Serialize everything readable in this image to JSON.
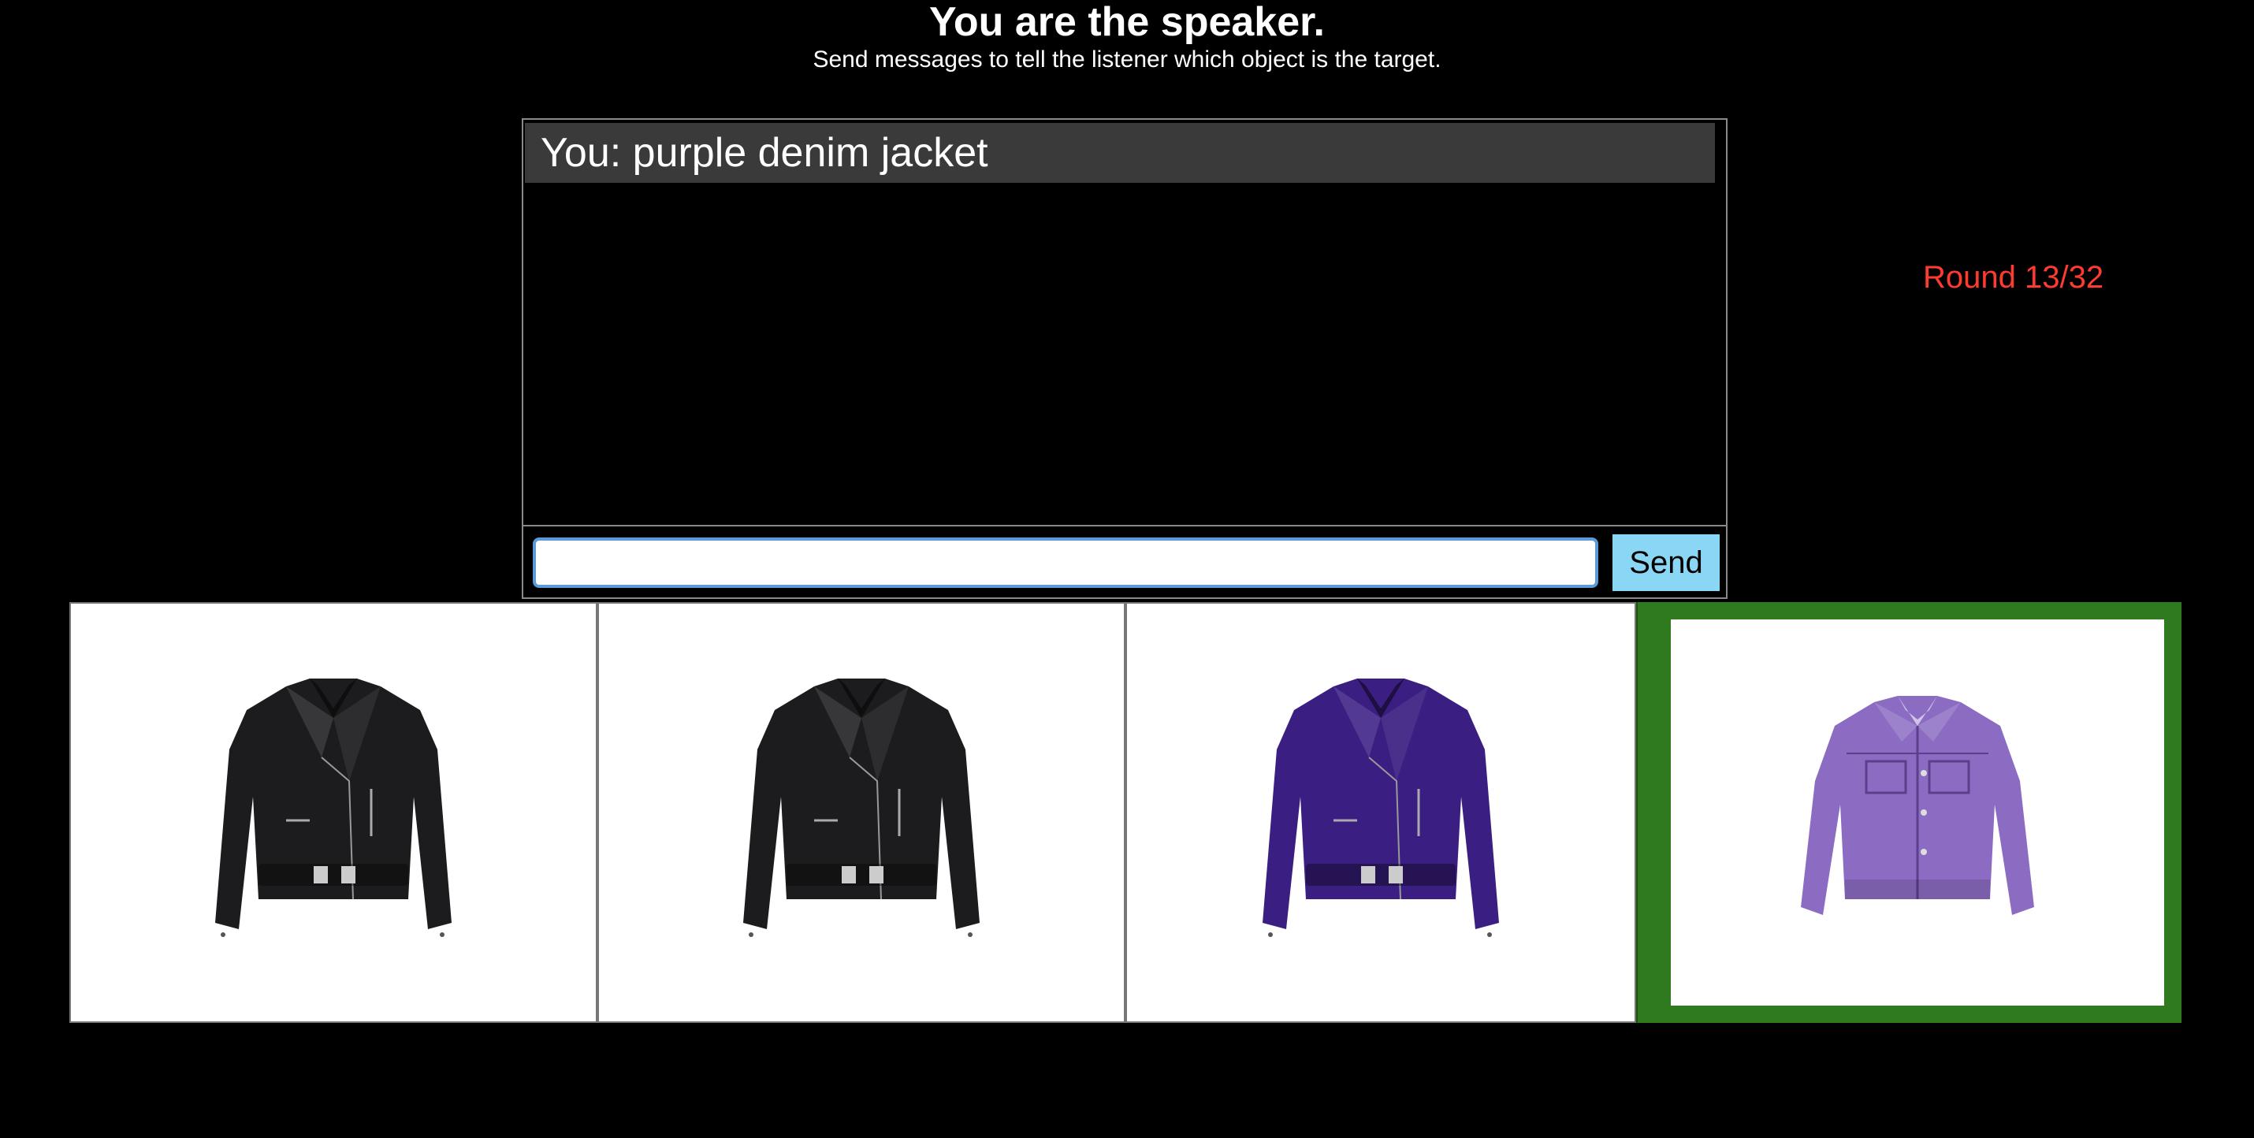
{
  "header": {
    "title": "You are the speaker.",
    "subtitle": "Send messages to tell the listener which object is the target."
  },
  "chat": {
    "messages": [
      {
        "text": "You: purple denim jacket"
      }
    ]
  },
  "composer": {
    "value": "",
    "placeholder": "",
    "send_label": "Send"
  },
  "status": {
    "round": "Round 13/32"
  },
  "objects": [
    {
      "name": "black leather jacket",
      "color": "#1c1c1e",
      "type": "leather"
    },
    {
      "name": "black leather jacket",
      "color": "#1c1c1e",
      "type": "leather"
    },
    {
      "name": "purple leather jacket",
      "color": "#3b1e82",
      "type": "leather"
    },
    {
      "name": "purple denim jacket",
      "color": "#8b6cc2",
      "type": "denim",
      "target": true
    }
  ],
  "colors": {
    "target_border": "#2f7a1f",
    "send_button": "#8ad6f5",
    "round_text": "#ff3b30",
    "chat_message_bg": "#3a3a3a"
  }
}
